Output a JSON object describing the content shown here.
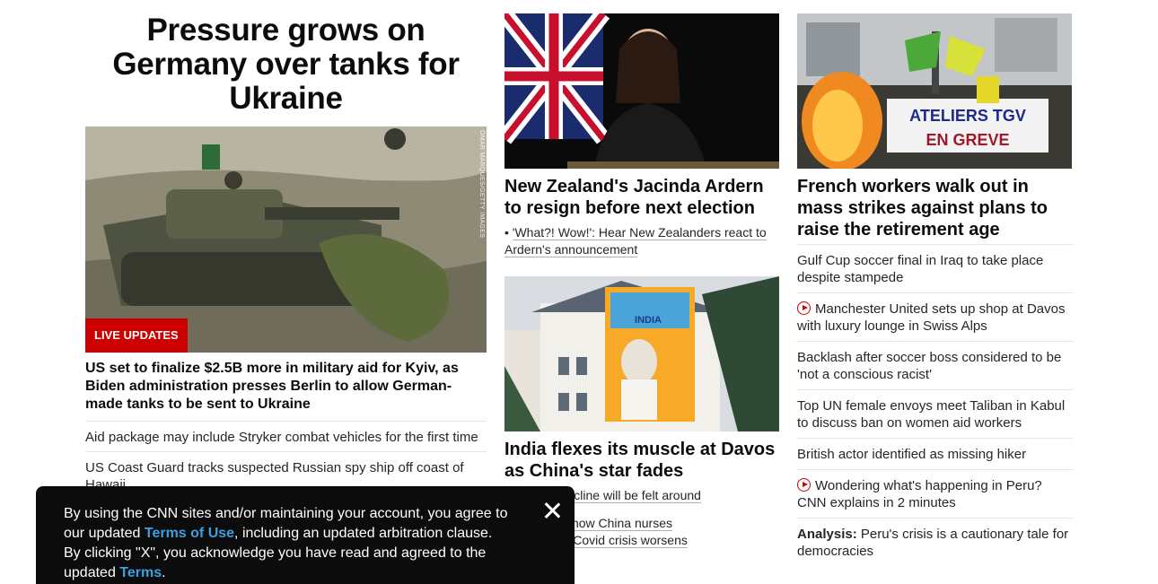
{
  "lead": {
    "title": "Pressure grows on Germany over tanks for Ukraine",
    "badge": "LIVE UPDATES",
    "photo_credit": "OMAR MARQUES/GETTY IMAGES",
    "headline": "US set to finalize $2.5B more in military aid for Kyiv, as Biden administration presses Berlin to allow German-made tanks to be sent to Ukraine",
    "links": [
      "Aid package may include Stryker combat vehicles for the first time",
      "US Coast Guard tracks suspected Russian spy ship off coast of Hawaii"
    ]
  },
  "middle": {
    "card1": {
      "title": "New Zealand's Jacinda Ardern to resign before next election",
      "sub": "'What?! Wow!': Hear New Zealanders react to Ardern's announcement"
    },
    "card2": {
      "title": "India flexes its muscle at Davos as China's star fades",
      "sub1": "pulation decline will be felt around",
      "sub2_a": "ia videos show China nurses",
      "sub2_b": "n the job as Covid crisis worsens"
    },
    "billboard_text": "INDIA"
  },
  "right": {
    "card_title": "French workers walk out in mass strikes against plans to raise the retirement age",
    "banner_line1": "ATELIERS TGV",
    "banner_line2": "EN GREVE",
    "items": [
      {
        "text": "Gulf Cup soccer final in Iraq to take place despite stampede",
        "video": false
      },
      {
        "text": "Manchester United sets up shop at Davos with luxury lounge in Swiss Alps",
        "video": true
      },
      {
        "text": "Backlash after soccer boss considered to be 'not a conscious racist'",
        "video": false
      },
      {
        "text": "Top UN female envoys meet Taliban in Kabul to discuss ban on women aid workers",
        "video": false
      },
      {
        "text": "British actor identified as missing hiker",
        "video": false
      },
      {
        "text": "Wondering what's happening in Peru? CNN explains in 2 minutes",
        "video": true
      },
      {
        "prefix": "Analysis:",
        "text": "Peru's crisis is a cautionary tale for democracies",
        "video": false
      }
    ]
  },
  "cookie": {
    "t1": "By using the CNN sites and/or maintaining your account, you agree to our updated ",
    "link1": "Terms of Use",
    "t2": ", including an updated arbitration clause. By clicking \"X\", you acknowledge you have read and agreed to the updated ",
    "link2": "Terms",
    "t3": "."
  },
  "colors": {
    "accent": "#cc0000",
    "link_blue": "#3aa0e0",
    "cookie_bg": "#0c0c0c"
  }
}
